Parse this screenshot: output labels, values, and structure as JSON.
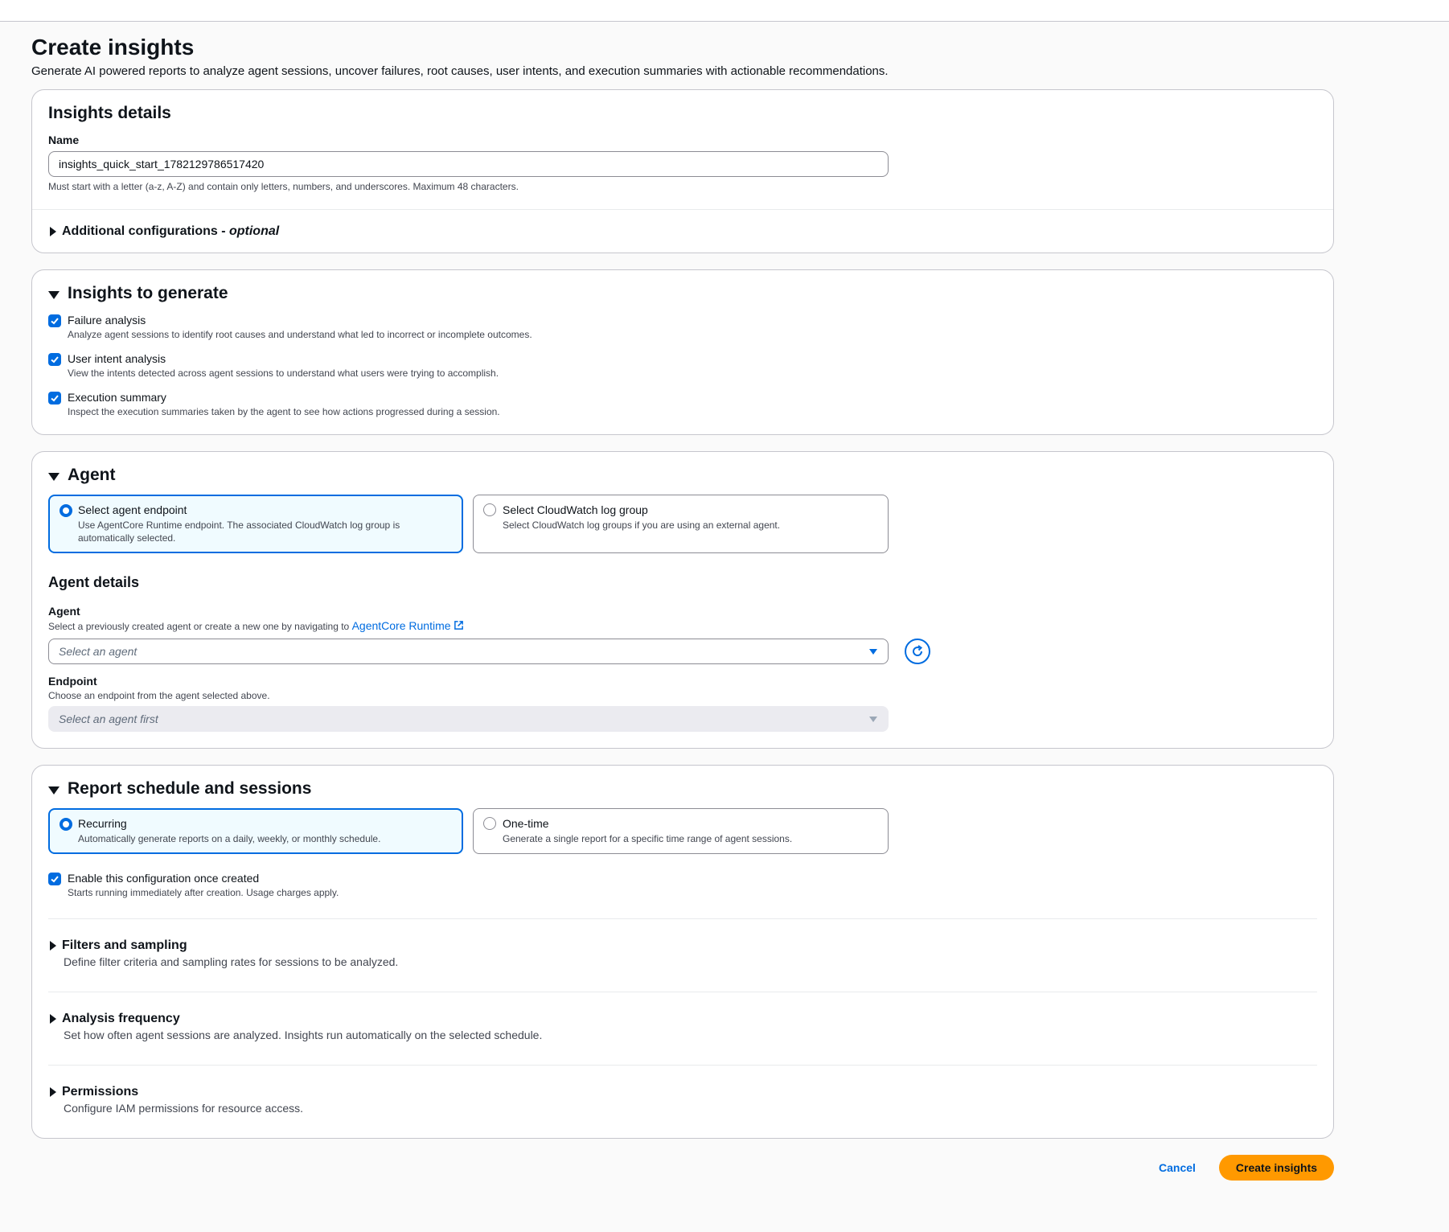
{
  "page": {
    "title": "Create insights",
    "description": "Generate AI powered reports to analyze agent sessions, uncover failures, root causes, user intents, and execution summaries with actionable recommendations."
  },
  "insights_details": {
    "heading": "Insights details",
    "name_label": "Name",
    "name_value": "insights_quick_start_1782129786517420",
    "name_hint": "Must start with a letter (a-z, A-Z) and contain only letters, numbers, and underscores. Maximum 48 characters.",
    "additional_label": "Additional configurations - ",
    "additional_optional": "optional"
  },
  "insights_to_generate": {
    "heading": "Insights to generate",
    "options": [
      {
        "label": "Failure analysis",
        "description": "Analyze agent sessions to identify root causes and understand what led to incorrect or incomplete outcomes.",
        "checked": true
      },
      {
        "label": "User intent analysis",
        "description": "View the intents detected across agent sessions to understand what users were trying to accomplish.",
        "checked": true
      },
      {
        "label": "Execution summary",
        "description": "Inspect the execution summaries taken by the agent to see how actions progressed during a session.",
        "checked": true
      }
    ]
  },
  "agent": {
    "heading": "Agent",
    "tiles": [
      {
        "label": "Select agent endpoint",
        "description": "Use AgentCore Runtime endpoint. The associated CloudWatch log group is automatically selected.",
        "selected": true
      },
      {
        "label": "Select CloudWatch log group",
        "description": "Select CloudWatch log groups if you are using an external agent.",
        "selected": false
      }
    ],
    "details_heading": "Agent details",
    "agent_label": "Agent",
    "agent_hint": "Select a previously created agent or create a new one by navigating to ",
    "agent_link": "AgentCore Runtime",
    "agent_placeholder": "Select an agent",
    "endpoint_label": "Endpoint",
    "endpoint_hint": "Choose an endpoint from the agent selected above.",
    "endpoint_placeholder": "Select an agent first"
  },
  "report": {
    "heading": "Report schedule and sessions",
    "tiles": [
      {
        "label": "Recurring",
        "description": "Automatically generate reports on a daily, weekly, or monthly schedule.",
        "selected": true
      },
      {
        "label": "One-time",
        "description": "Generate a single report for a specific time range of agent sessions.",
        "selected": false
      }
    ],
    "enable_label": "Enable this configuration once created",
    "enable_desc": "Starts running immediately after creation. Usage charges apply.",
    "enable_checked": true,
    "sections": [
      {
        "label": "Filters and sampling",
        "description": "Define filter criteria and sampling rates for sessions to be analyzed."
      },
      {
        "label": "Analysis frequency",
        "description": "Set how often agent sessions are analyzed. Insights run automatically on the selected schedule."
      },
      {
        "label": "Permissions",
        "description": "Configure IAM permissions for resource access."
      }
    ]
  },
  "footer": {
    "cancel_label": "Cancel",
    "create_label": "Create insights"
  },
  "colors": {
    "accent": "#006ce0",
    "primary_button": "#ff9900",
    "selected_tile_bg": "#f0fbff"
  }
}
